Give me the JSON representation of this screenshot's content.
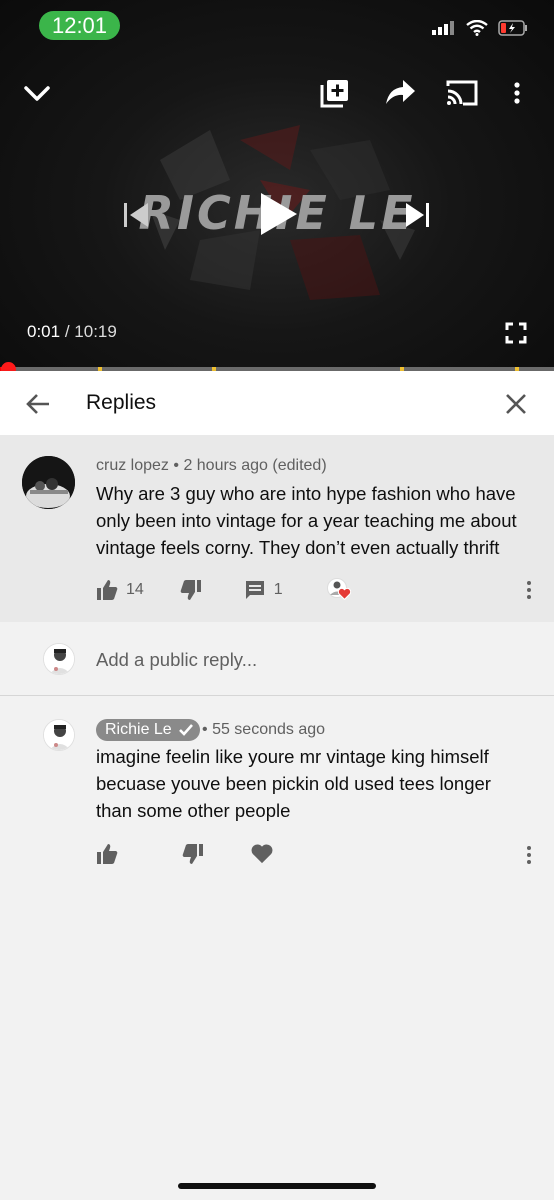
{
  "status_bar": {
    "time": "12:01"
  },
  "player": {
    "title_overlay": "RICHIE LE",
    "current_time": "0:01",
    "separator": "/",
    "duration": "10:19",
    "progress_fraction": 0.0016
  },
  "replies_header": {
    "title": "Replies"
  },
  "parent_comment": {
    "author": "cruz lopez",
    "time": "2 hours ago",
    "edited": "(edited)",
    "text": "Why are 3 guy who are into hype fashion who have only been into vintage for a year teaching me about vintage feels corny. They don’t even actually thrift",
    "likes": "14",
    "replies": "1",
    "creator_hearted": true
  },
  "reply_input": {
    "placeholder": "Add a public reply..."
  },
  "reply_comment": {
    "author": "Richie Le",
    "verified": true,
    "time": "55 seconds ago",
    "text": "imagine feelin like youre mr vintage king himself becuase youve been pickin old used tees longer than some other people"
  },
  "colors": {
    "accent_red": "#ff0000",
    "status_green": "#3bb54a",
    "heart_red": "#e53935"
  }
}
